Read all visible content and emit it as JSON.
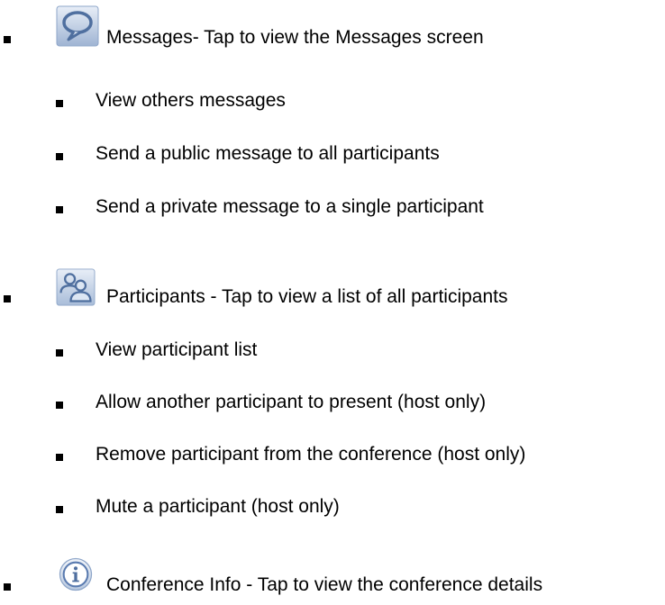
{
  "sections": {
    "messages": {
      "icon": "speech-bubble-icon",
      "label": "Messages- Tap to view the Messages screen",
      "items": [
        "View others messages",
        "Send a public message to all participants",
        "Send a private message to a single participant"
      ]
    },
    "participants": {
      "icon": "participants-icon",
      "label": "Participants - Tap to view a list of all participants",
      "items": [
        "View participant list",
        "Allow another participant to present (host only)",
        "Remove participant from the conference (host only)",
        "Mute a participant (host only)"
      ]
    },
    "info": {
      "icon": "info-icon",
      "label": "Conference Info - Tap to view the conference details"
    }
  },
  "colors": {
    "icon_frame_top": "#dce6f3",
    "icon_frame_bottom": "#9fb4d3",
    "icon_stroke": "#5a7bb0"
  }
}
